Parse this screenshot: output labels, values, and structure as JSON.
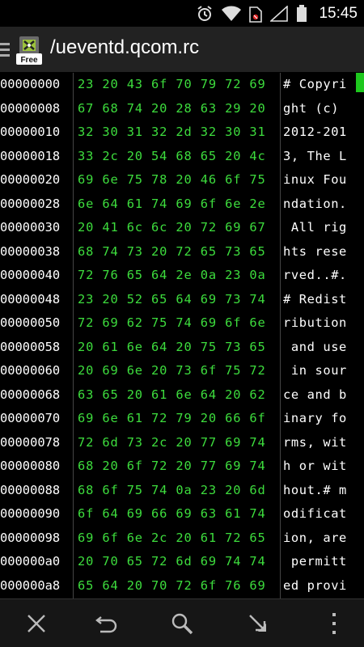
{
  "status_bar": {
    "time": "15:45",
    "icons": [
      "alarm-icon",
      "wifi-icon",
      "no-sim-icon",
      "signal-icon",
      "battery-icon"
    ]
  },
  "action_bar": {
    "title": "/ueventd.qcom.rc",
    "logo_badge": "Free"
  },
  "hex_rows": [
    {
      "addr": "00000000",
      "bytes": "23 20 43 6f 70 79 72 69",
      "ascii": "# Copyri"
    },
    {
      "addr": "00000008",
      "bytes": "67 68 74 20 28 63 29 20",
      "ascii": "ght (c) "
    },
    {
      "addr": "00000010",
      "bytes": "32 30 31 32 2d 32 30 31",
      "ascii": "2012-201"
    },
    {
      "addr": "00000018",
      "bytes": "33 2c 20 54 68 65 20 4c",
      "ascii": "3, The L"
    },
    {
      "addr": "00000020",
      "bytes": "69 6e 75 78 20 46 6f 75",
      "ascii": "inux Fou"
    },
    {
      "addr": "00000028",
      "bytes": "6e 64 61 74 69 6f 6e 2e",
      "ascii": "ndation."
    },
    {
      "addr": "00000030",
      "bytes": "20 41 6c 6c 20 72 69 67",
      "ascii": " All rig"
    },
    {
      "addr": "00000038",
      "bytes": "68 74 73 20 72 65 73 65",
      "ascii": "hts rese"
    },
    {
      "addr": "00000040",
      "bytes": "72 76 65 64 2e 0a 23 0a",
      "ascii": "rved..#."
    },
    {
      "addr": "00000048",
      "bytes": "23 20 52 65 64 69 73 74",
      "ascii": "# Redist"
    },
    {
      "addr": "00000050",
      "bytes": "72 69 62 75 74 69 6f 6e",
      "ascii": "ribution"
    },
    {
      "addr": "00000058",
      "bytes": "20 61 6e 64 20 75 73 65",
      "ascii": " and use"
    },
    {
      "addr": "00000060",
      "bytes": "20 69 6e 20 73 6f 75 72",
      "ascii": " in sour"
    },
    {
      "addr": "00000068",
      "bytes": "63 65 20 61 6e 64 20 62",
      "ascii": "ce and b"
    },
    {
      "addr": "00000070",
      "bytes": "69 6e 61 72 79 20 66 6f",
      "ascii": "inary fo"
    },
    {
      "addr": "00000078",
      "bytes": "72 6d 73 2c 20 77 69 74",
      "ascii": "rms, wit"
    },
    {
      "addr": "00000080",
      "bytes": "68 20 6f 72 20 77 69 74",
      "ascii": "h or wit"
    },
    {
      "addr": "00000088",
      "bytes": "68 6f 75 74 0a 23 20 6d",
      "ascii": "hout.# m"
    },
    {
      "addr": "00000090",
      "bytes": "6f 64 69 66 69 63 61 74",
      "ascii": "odificat"
    },
    {
      "addr": "00000098",
      "bytes": "69 6f 6e 2c 20 61 72 65",
      "ascii": "ion, are"
    },
    {
      "addr": "000000a0",
      "bytes": "20 70 65 72 6d 69 74 74",
      "ascii": " permitt"
    },
    {
      "addr": "000000a8",
      "bytes": "65 64 20 70 72 6f 76 69",
      "ascii": "ed provi"
    }
  ],
  "bottom_bar": {
    "buttons": [
      {
        "name": "close-button",
        "icon": "close-icon"
      },
      {
        "name": "undo-button",
        "icon": "undo-icon"
      },
      {
        "name": "search-button",
        "icon": "search-icon"
      },
      {
        "name": "goto-button",
        "icon": "goto-arrow-icon"
      },
      {
        "name": "overflow-menu-button",
        "icon": "more-vert-icon"
      }
    ]
  },
  "colors": {
    "hex_bytes": "#3ddc3d",
    "cursor": "#1ec81e",
    "action_bar": "#222222",
    "background": "#000000"
  }
}
